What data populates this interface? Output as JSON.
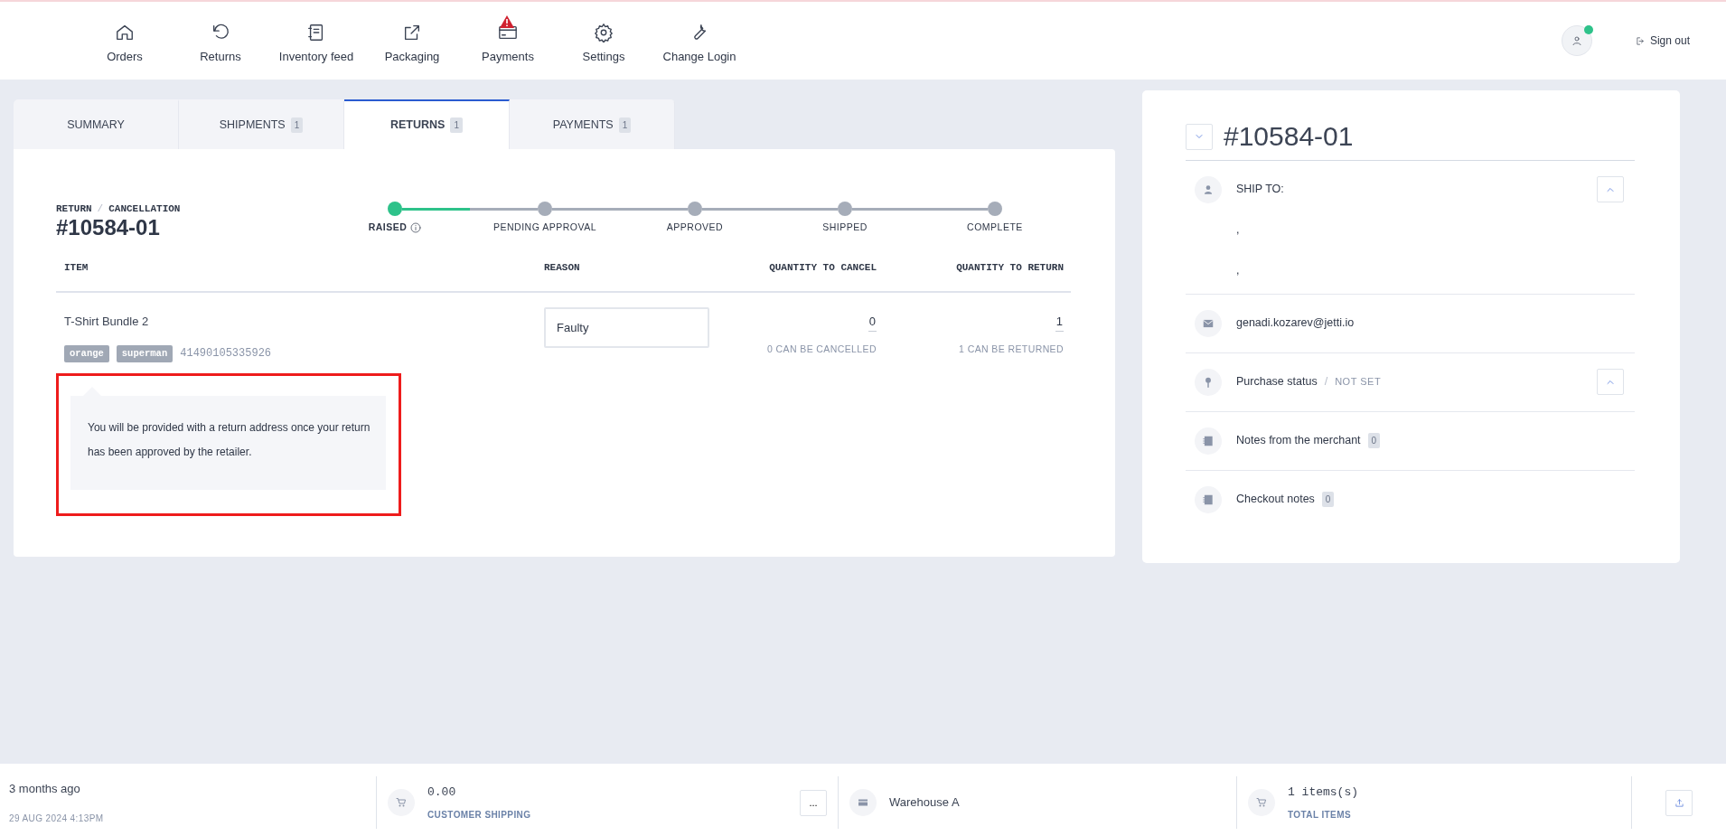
{
  "nav": {
    "items": [
      {
        "label": "Orders",
        "alert": false
      },
      {
        "label": "Returns",
        "alert": false
      },
      {
        "label": "Inventory feed",
        "alert": false
      },
      {
        "label": "Packaging",
        "alert": false
      },
      {
        "label": "Payments",
        "alert": true
      },
      {
        "label": "Settings",
        "alert": false
      },
      {
        "label": "Change Login",
        "alert": false
      }
    ],
    "user": {
      "online": true
    },
    "sign_out": "Sign out"
  },
  "tabs": [
    {
      "label": "SUMMARY",
      "selected": false
    },
    {
      "label": "SHIPMENTS",
      "count": "1",
      "selected": false
    },
    {
      "label": "RETURNS",
      "count": "1",
      "selected": true
    },
    {
      "label": "PAYMENTS",
      "count": "1",
      "selected": false
    }
  ],
  "return": {
    "label": "RETURN",
    "separator": "/",
    "sublabel": "CANCELLATION",
    "number": "#10584-01"
  },
  "progress": {
    "steps": [
      {
        "label": "RAISED",
        "done": true,
        "info": true,
        "level": 0.5
      },
      {
        "label": "PENDING APPROVAL",
        "done": false,
        "info": false,
        "level": 0
      },
      {
        "label": "APPROVED",
        "done": false,
        "info": false,
        "level": 0
      },
      {
        "label": "SHIPPED",
        "done": false,
        "info": false,
        "level": 0
      },
      {
        "label": "COMPLETE",
        "done": false,
        "info": false
      }
    ]
  },
  "table": {
    "columns": [
      "ITEM",
      "REASON",
      "QUANTITY TO CANCEL",
      "QUANTITY TO RETURN"
    ],
    "rows": [
      {
        "item": "T-Shirt Bundle 2",
        "tags": [
          "orange",
          "superman"
        ],
        "sku": "41490105335926",
        "reason": "Faulty",
        "qty_cancel": "0",
        "cancel_note": "0 CAN BE CANCELLED",
        "qty_return": "1",
        "return_note": "1 CAN BE RETURNED"
      }
    ]
  },
  "notice": {
    "text": "You will be provided with a return address once your return has been approved by the retailer.",
    "highlighted": true
  },
  "order": {
    "number": "#10584-01",
    "sections": [
      {
        "kind": "address",
        "title": "SHIP TO:",
        "lines": [
          ",",
          ","
        ],
        "collapse_button": true
      },
      {
        "kind": "email",
        "title": "genadi.kozarev@jetti.io",
        "collapse_button": false
      },
      {
        "kind": "status",
        "title": "Purchase status",
        "separator": "/",
        "value": "NOT SET",
        "collapse_button": true
      },
      {
        "kind": "notes",
        "title": "Notes from the merchant",
        "count": "0",
        "collapse_button": false
      },
      {
        "kind": "notes",
        "title": "Checkout notes",
        "count": "0",
        "collapse_button": false
      }
    ]
  },
  "footer": {
    "time_ago": "3 months ago",
    "date": "29 AUG 2024 4:13PM",
    "shipping": {
      "value": "0.00",
      "label": "CUSTOMER SHIPPING",
      "more": "..."
    },
    "warehouse": "Warehouse A",
    "items": {
      "value": "1 items(s)",
      "label": "TOTAL ITEMS"
    }
  }
}
